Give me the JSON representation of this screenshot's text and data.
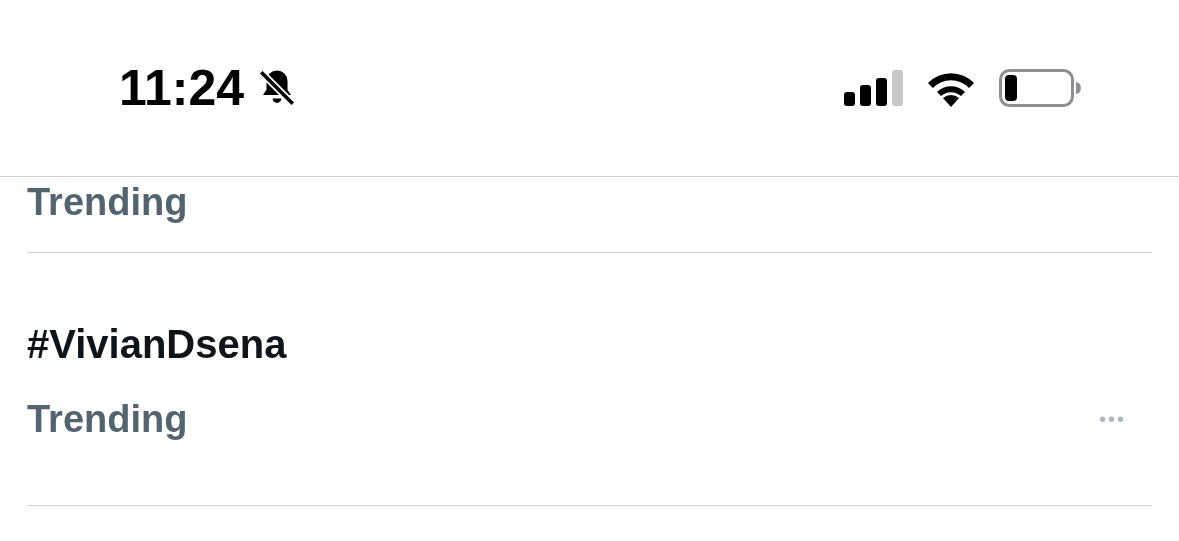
{
  "status_bar": {
    "time": "11:24"
  },
  "trends": [
    {
      "category": "Trending"
    },
    {
      "title": "#VivianDsena",
      "category": "Trending",
      "more": "•••"
    }
  ]
}
